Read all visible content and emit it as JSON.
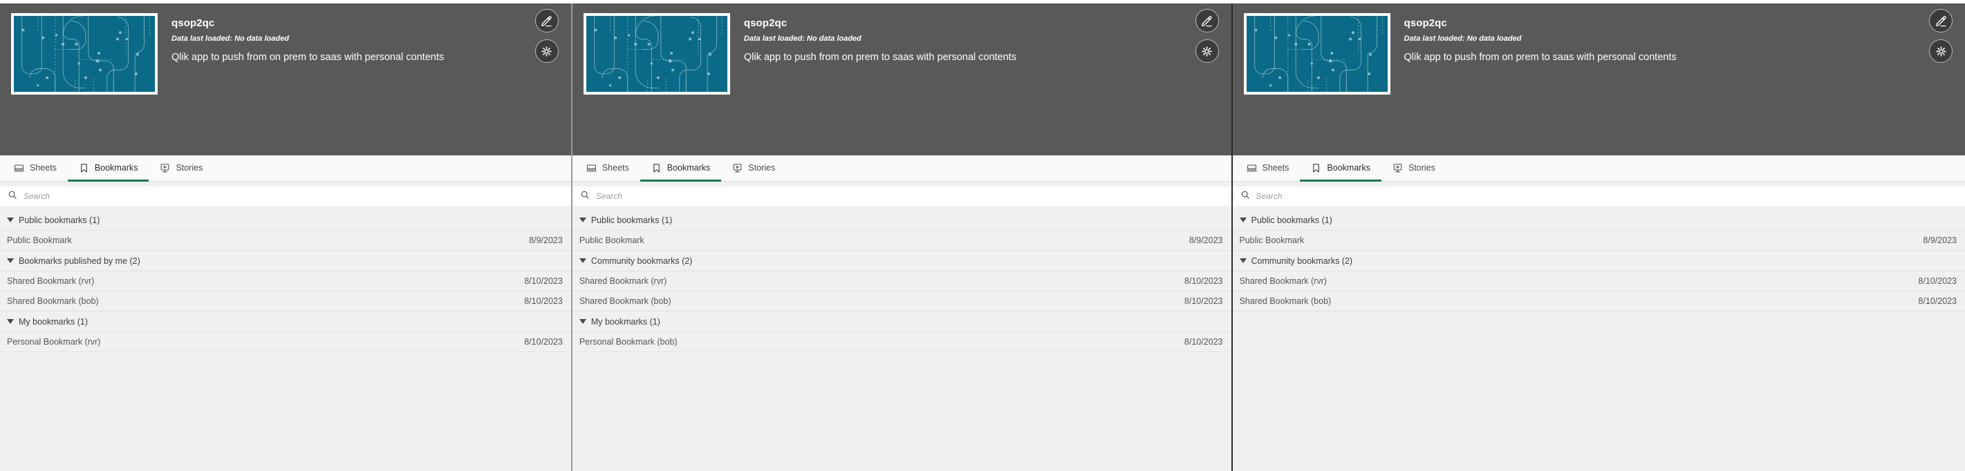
{
  "app": {
    "title": "qsop2qc",
    "subtitle": "Data last loaded: No data loaded",
    "description": "Qlik app to push from on prem to saas with personal contents",
    "edit_icon": "pencil-icon",
    "settings_icon": "gear-icon",
    "thumbnail_bg": "#0a6a87"
  },
  "tabs": [
    {
      "label": "Sheets",
      "icon": "sheet-icon",
      "active": false
    },
    {
      "label": "Bookmarks",
      "icon": "bookmark-icon",
      "active": true
    },
    {
      "label": "Stories",
      "icon": "story-icon",
      "active": false
    }
  ],
  "search": {
    "placeholder": "Search",
    "value": "",
    "icon": "search-icon"
  },
  "colors": {
    "accent": "#177a48",
    "header_bg": "#595959",
    "panel_bg": "#f0f0f0"
  },
  "panels": [
    {
      "id": "panel-1",
      "groups": [
        {
          "title": "Public bookmarks (1)",
          "items": [
            {
              "name": "Public Bookmark",
              "date": "8/9/2023"
            }
          ]
        },
        {
          "title": "Bookmarks published by me (2)",
          "items": [
            {
              "name": "Shared Bookmark (rvr)",
              "date": "8/10/2023"
            },
            {
              "name": "Shared Bookmark (bob)",
              "date": "8/10/2023"
            }
          ]
        },
        {
          "title": "My bookmarks (1)",
          "items": [
            {
              "name": "Personal Bookmark (rvr)",
              "date": "8/10/2023"
            }
          ]
        }
      ]
    },
    {
      "id": "panel-2",
      "groups": [
        {
          "title": "Public bookmarks (1)",
          "items": [
            {
              "name": "Public Bookmark",
              "date": "8/9/2023"
            }
          ]
        },
        {
          "title": "Community bookmarks (2)",
          "items": [
            {
              "name": "Shared Bookmark (rvr)",
              "date": "8/10/2023"
            },
            {
              "name": "Shared Bookmark (bob)",
              "date": "8/10/2023"
            }
          ]
        },
        {
          "title": "My bookmarks (1)",
          "items": [
            {
              "name": "Personal Bookmark (bob)",
              "date": "8/10/2023"
            }
          ]
        }
      ]
    },
    {
      "id": "panel-3",
      "groups": [
        {
          "title": "Public bookmarks (1)",
          "items": [
            {
              "name": "Public Bookmark",
              "date": "8/9/2023"
            }
          ]
        },
        {
          "title": "Community bookmarks (2)",
          "items": [
            {
              "name": "Shared Bookmark (rvr)",
              "date": "8/10/2023"
            },
            {
              "name": "Shared Bookmark (bob)",
              "date": "8/10/2023"
            }
          ]
        }
      ]
    }
  ]
}
